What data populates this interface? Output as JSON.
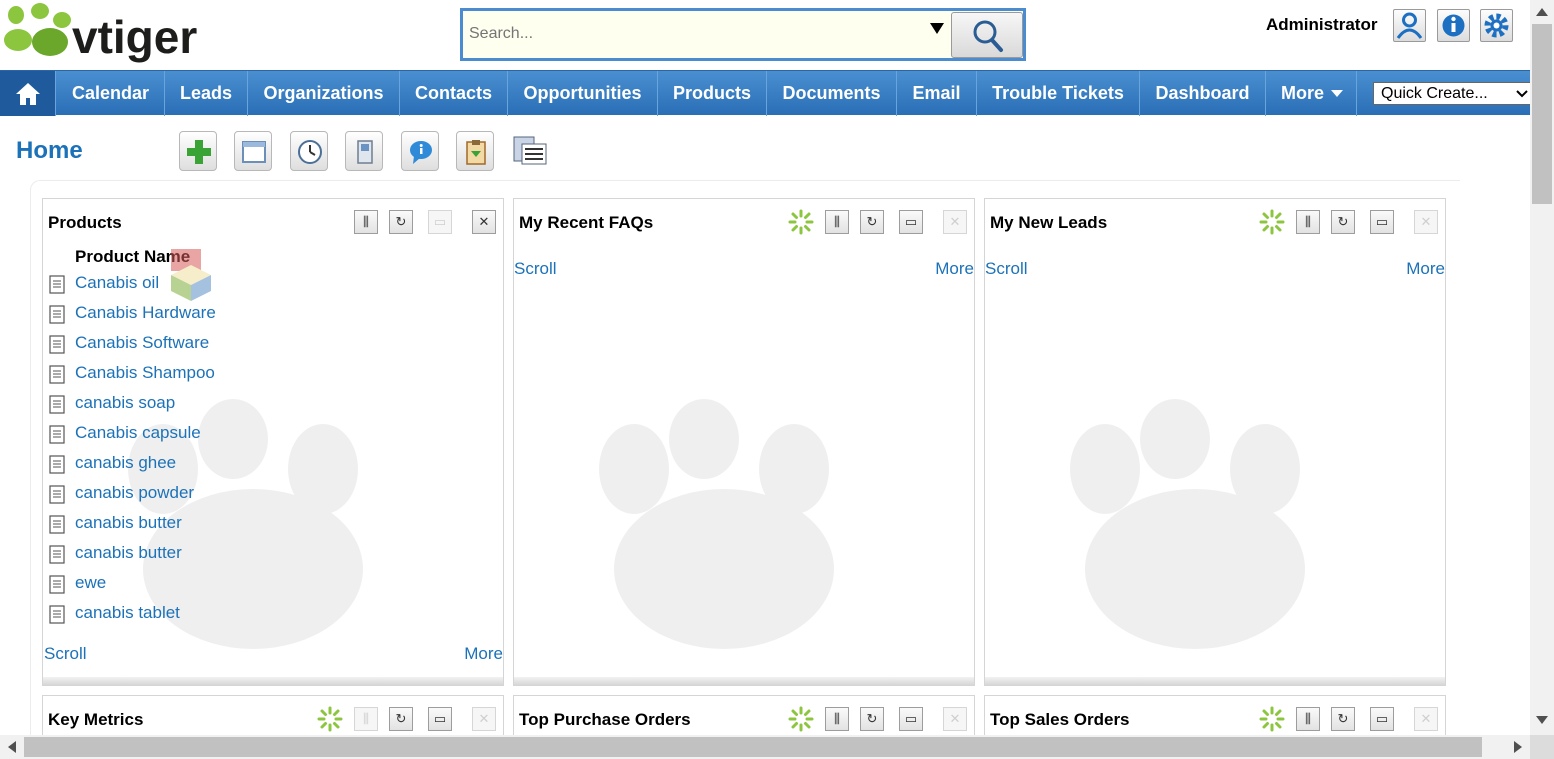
{
  "logo": {
    "text": "vtiger",
    "accent": "#8cc63f"
  },
  "search": {
    "placeholder": "Search...",
    "dropdown_icon": "caret-down-icon",
    "button_icon": "magnifier-icon"
  },
  "user": {
    "name": "Administrator",
    "icons": [
      "user-icon",
      "info-icon",
      "settings-gear-icon"
    ]
  },
  "nav": {
    "home_icon": "home-icon",
    "items": [
      {
        "label": "Calendar"
      },
      {
        "label": "Leads"
      },
      {
        "label": "Organizations"
      },
      {
        "label": "Contacts"
      },
      {
        "label": "Opportunities"
      },
      {
        "label": "Products"
      },
      {
        "label": "Documents"
      },
      {
        "label": "Email"
      },
      {
        "label": "Trouble Tickets"
      },
      {
        "label": "Dashboard"
      },
      {
        "label": "More"
      }
    ],
    "more_icon": "caret-down-icon",
    "quick_create": "Quick Create...",
    "bar_color": "#2f77c0"
  },
  "page": {
    "title": "Home",
    "toolbar": [
      "add-widget-icon",
      "window-icon",
      "clock-icon",
      "notebook-icon",
      "chat-bubble-icon",
      "clipboard-icon",
      "list-layout-icon"
    ]
  },
  "widgets": {
    "products": {
      "title": "Products",
      "column_header": "Product Name",
      "rows": [
        "Canabis oil",
        "Canabis Hardware",
        "Canabis Software",
        "Canabis Shampoo",
        "canabis soap",
        "Canabis capsule",
        "canabis ghee",
        "canabis powder",
        "canabis butter",
        "canabis butter",
        "ewe",
        "canabis tablet"
      ],
      "scroll": "Scroll",
      "more": "More"
    },
    "faqs": {
      "title": "My Recent FAQs",
      "scroll": "Scroll",
      "more": "More"
    },
    "leads": {
      "title": "My New Leads",
      "scroll": "Scroll",
      "more": "More"
    },
    "key_metrics": {
      "title": "Key Metrics"
    },
    "purchase_orders": {
      "title": "Top Purchase Orders"
    },
    "sales_orders": {
      "title": "Top Sales Orders"
    }
  },
  "colors": {
    "link": "#1c72b8",
    "spinner": "#8cc63f"
  }
}
